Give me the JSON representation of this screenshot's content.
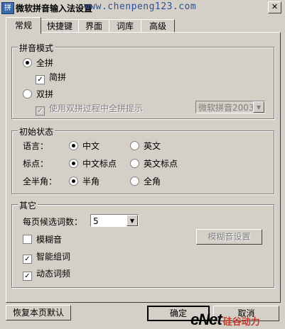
{
  "window": {
    "title": "微软拼音输入法设置",
    "watermark": "www.chenpeng123.com",
    "close_glyph": "✕"
  },
  "tabs": [
    {
      "label": "常规",
      "active": true
    },
    {
      "label": "快捷键",
      "active": false
    },
    {
      "label": "界面",
      "active": false
    },
    {
      "label": "词库",
      "active": false
    },
    {
      "label": "高级",
      "active": false
    }
  ],
  "pinyin_mode": {
    "legend": "拼音模式",
    "quanpin": "全拼",
    "jianpin": "简拼",
    "shuangpin": "双拼",
    "hint": "使用双拼过程中全拼提示",
    "scheme_value": "微软拼音2003",
    "quanpin_selected": true,
    "jianpin_checked": true,
    "hint_checked": true
  },
  "initial_state": {
    "legend": "初始状态",
    "language_label": "语言：",
    "language_options": [
      "中文",
      "英文"
    ],
    "punct_label": "标点：",
    "punct_options": [
      "中文标点",
      "英文标点"
    ],
    "width_label": "全半角：",
    "width_options": [
      "半角",
      "全角"
    ],
    "selected": {
      "language": "中文",
      "punct": "中文标点",
      "width": "半角"
    }
  },
  "other": {
    "legend": "其它",
    "candidates_label": "每页候选词数：",
    "candidates_value": "5",
    "fuzzy": "模糊音",
    "fuzzy_checked": false,
    "fuzzy_settings_button": "模糊音设置",
    "smart": "智能组词",
    "smart_checked": true,
    "dynamic": "动态词频",
    "dynamic_checked": true
  },
  "footer": {
    "restore_button": "恢复本页默认",
    "ok_button": "确定",
    "cancel_button": "取消",
    "brand_latin": "eNet",
    "brand_cn": "硅谷动力"
  },
  "icons": {
    "check": "✓",
    "dropdown": "▼"
  }
}
